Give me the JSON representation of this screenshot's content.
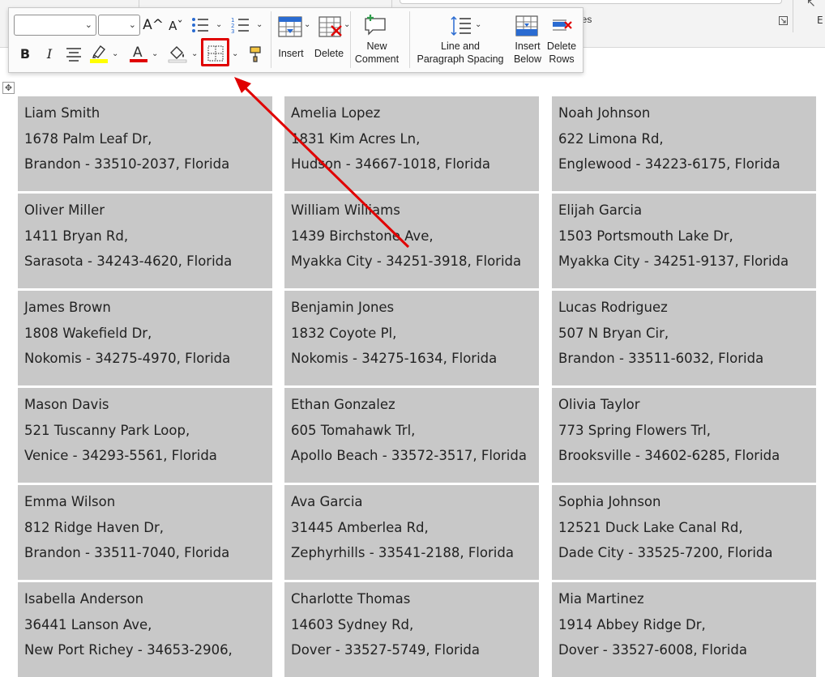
{
  "ribbon_bg": {
    "group_label": "les",
    "letter_e": "E"
  },
  "mini_toolbar": {
    "font_name_value": "",
    "font_size_value": "",
    "grow_font": "A^",
    "shrink_font": "Aˇ",
    "bold": "B",
    "italic": "I",
    "insert_label": "Insert",
    "delete_label": "Delete",
    "new_comment_label": [
      "New",
      "Comment"
    ],
    "line_spacing_label": [
      "Line and",
      "Paragraph Spacing"
    ],
    "insert_below_label": [
      "Insert",
      "Below"
    ],
    "delete_rows_label": [
      "Delete",
      "Rows"
    ]
  },
  "colors": {
    "highlight": "#ffff00",
    "font_color": "#e00000",
    "annotation": "#e00000",
    "cell_bg": "#c8c8c8"
  },
  "labels": [
    [
      {
        "name": "Liam Smith",
        "street": "1678 Palm Leaf Dr,",
        "city": "Brandon - 33510-2037, Florida"
      },
      {
        "name": "Amelia Lopez",
        "street": "1831 Kim Acres Ln,",
        "city": "Hudson - 34667-1018, Florida"
      },
      {
        "name": "Noah Johnson",
        "street": "622 Limona Rd,",
        "city": "Englewood - 34223-6175, Florida"
      }
    ],
    [
      {
        "name": "Oliver Miller",
        "street": "1411 Bryan Rd,",
        "city": "Sarasota - 34243-4620, Florida"
      },
      {
        "name": "William Williams",
        "street": "1439 Birchstone Ave,",
        "city": "Myakka City - 34251-3918, Florida"
      },
      {
        "name": "Elijah Garcia",
        "street": "1503 Portsmouth Lake Dr,",
        "city": "Myakka City - 34251-9137, Florida"
      }
    ],
    [
      {
        "name": "James Brown",
        "street": "1808 Wakefield Dr,",
        "city": "Nokomis - 34275-4970, Florida"
      },
      {
        "name": "Benjamin Jones",
        "street": "1832 Coyote Pl,",
        "city": "Nokomis - 34275-1634, Florida"
      },
      {
        "name": "Lucas Rodriguez",
        "street": "507 N Bryan Cir,",
        "city": "Brandon - 33511-6032, Florida"
      }
    ],
    [
      {
        "name": "Mason Davis",
        "street": "521 Tuscanny Park Loop,",
        "city": "Venice - 34293-5561, Florida"
      },
      {
        "name": "Ethan Gonzalez",
        "street": "605 Tomahawk Trl,",
        "city": "Apollo Beach - 33572-3517, Florida"
      },
      {
        "name": "Olivia Taylor",
        "street": "773 Spring Flowers Trl,",
        "city": "Brooksville - 34602-6285, Florida"
      }
    ],
    [
      {
        "name": "Emma Wilson",
        "street": "812 Ridge Haven Dr,",
        "city": "Brandon - 33511-7040, Florida"
      },
      {
        "name": "Ava Garcia",
        "street": "31445 Amberlea Rd,",
        "city": "Zephyrhills - 33541-2188, Florida"
      },
      {
        "name": "Sophia Johnson",
        "street": "12521 Duck Lake Canal Rd,",
        "city": "Dade City - 33525-7200, Florida"
      }
    ],
    [
      {
        "name": "Isabella Anderson",
        "street": "36441 Lanson Ave,",
        "city": "New Port Richey - 34653-2906,"
      },
      {
        "name": "Charlotte Thomas",
        "street": "14603 Sydney Rd,",
        "city": "Dover - 33527-5749, Florida"
      },
      {
        "name": "Mia Martinez",
        "street": "1914 Abbey Ridge Dr,",
        "city": "Dover - 33527-6008, Florida"
      }
    ]
  ]
}
